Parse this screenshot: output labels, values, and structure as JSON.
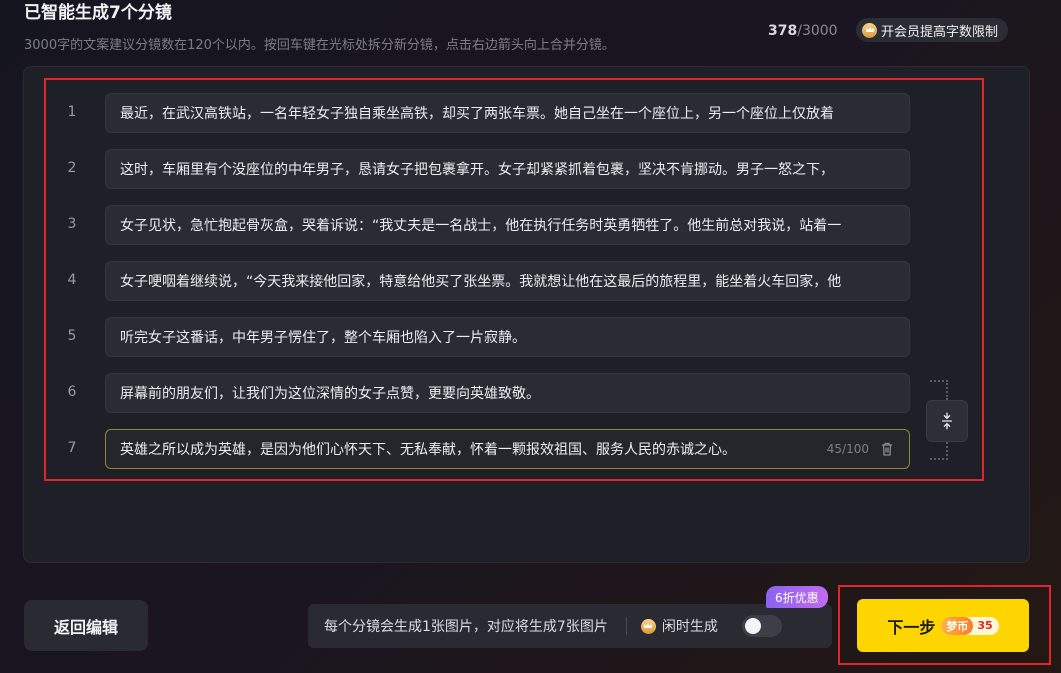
{
  "header": {
    "title": "已智能生成7个分镜",
    "hint": "3000字的文案建议分镜数在120个以内。按回车键在光标处拆分新分镜，点击右边箭头向上合并分镜。",
    "char_count_current": "378",
    "char_count_separator": "/",
    "char_count_max": "3000",
    "vip_label": "开会员提高字数限制"
  },
  "segments": [
    {
      "num": "1",
      "text": "最近，在武汉高铁站，一名年轻女子独自乘坐高铁，却买了两张车票。她自己坐在一个座位上，另一个座位上仅放着"
    },
    {
      "num": "2",
      "text": "这时，车厢里有个没座位的中年男子，恳请女子把包裹拿开。女子却紧紧抓着包裹，坚决不肯挪动。男子一怒之下，"
    },
    {
      "num": "3",
      "text": "女子见状，急忙抱起骨灰盒，哭着诉说：“我丈夫是一名战士，他在执行任务时英勇牺牲了。他生前总对我说，站着一"
    },
    {
      "num": "4",
      "text": "女子哽咽着继续说，“今天我来接他回家，特意给他买了张坐票。我就想让他在这最后的旅程里，能坐着火车回家，他"
    },
    {
      "num": "5",
      "text": "听完女子这番话，中年男子愣住了，整个车厢也陷入了一片寂静。"
    },
    {
      "num": "6",
      "text": "屏幕前的朋友们，让我们为这位深情的女子点赞，更要向英雄致敬。"
    },
    {
      "num": "7",
      "text": "英雄之所以成为英雄，是因为他们心怀天下、无私奉献，怀着一颗报效祖国、服务人民的赤诚之心。",
      "count": "45/100"
    }
  ],
  "footer": {
    "back_label": "返回编辑",
    "info_text": "每个分镜会生成1张图片，对应将生成7张图片",
    "idle_label": "闲时生成",
    "idle_toggle_on": false,
    "discount_badge": "6折优惠",
    "next_label": "下一步",
    "coin_label": "梦币",
    "coin_cost": "35"
  },
  "colors": {
    "accent_yellow": "#ffd500",
    "highlight_red": "#e0262a",
    "discount_purple": "#8a63f0"
  },
  "icons": [
    "crown-icon",
    "trash-icon",
    "merge-up-icon"
  ]
}
